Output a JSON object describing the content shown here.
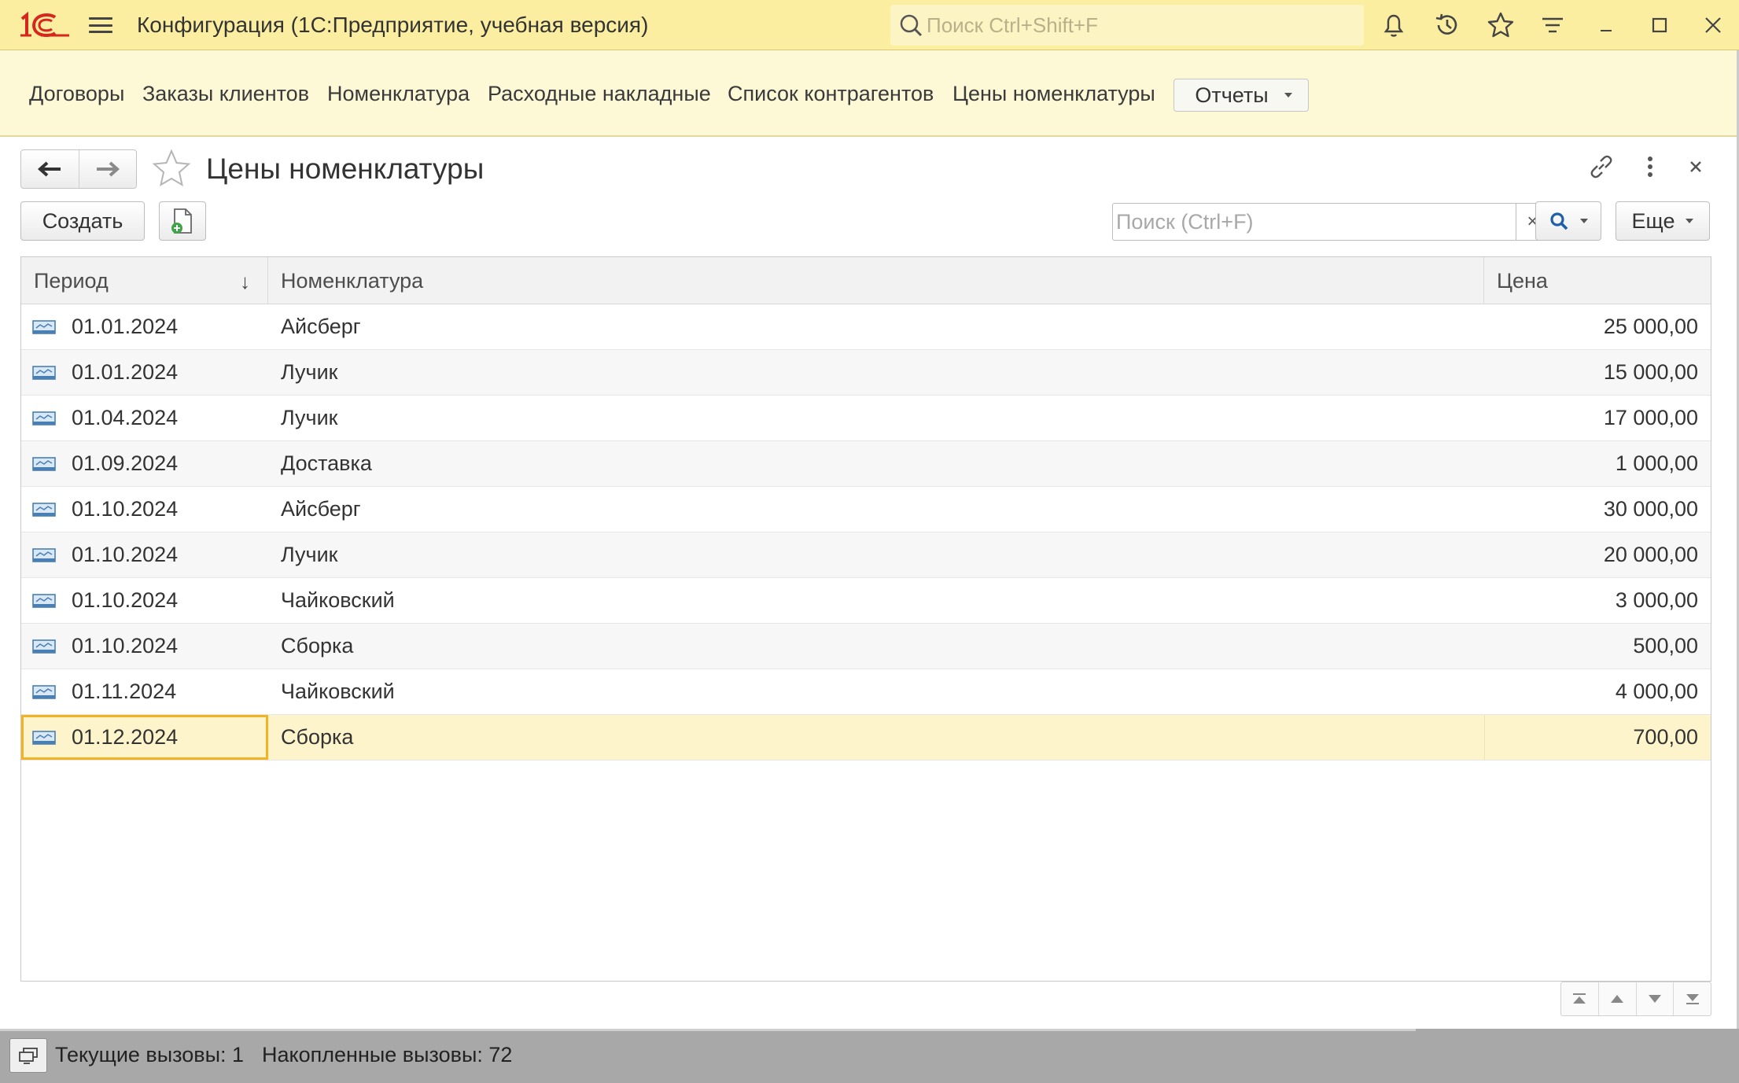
{
  "app": {
    "logo_text": "1С",
    "title": "Конфигурация  (1С:Предприятие, учебная версия)",
    "search_placeholder": "Поиск Ctrl+Shift+F",
    "icons": [
      "bell-icon",
      "history-icon",
      "star-icon",
      "funnel-menu-icon",
      "minimize-icon",
      "maximize-icon",
      "close-icon"
    ]
  },
  "sections": {
    "links": [
      "Договоры",
      "Заказы клиентов",
      "Номенклатура",
      "Расходные накладные",
      "Список контрагентов",
      "Цены номенклатуры"
    ],
    "reports_label": "Отчеты"
  },
  "form": {
    "title": "Цены номенклатуры",
    "create_label": "Создать",
    "search_placeholder": "Поиск (Ctrl+F)",
    "clear_label": "×",
    "more_label": "Еще"
  },
  "table": {
    "columns": {
      "period": "Период",
      "item": "Номенклатура",
      "price": "Цена"
    },
    "sort_indicator": "↓",
    "rows": [
      {
        "period": "01.01.2024",
        "item": "Айсберг",
        "price": "25 000,00"
      },
      {
        "period": "01.01.2024",
        "item": "Лучик",
        "price": "15 000,00"
      },
      {
        "period": "01.04.2024",
        "item": "Лучик",
        "price": "17 000,00"
      },
      {
        "period": "01.09.2024",
        "item": "Доставка",
        "price": "1 000,00"
      },
      {
        "period": "01.10.2024",
        "item": "Айсберг",
        "price": "30 000,00"
      },
      {
        "period": "01.10.2024",
        "item": "Лучик",
        "price": "20 000,00"
      },
      {
        "period": "01.10.2024",
        "item": "Чайковский",
        "price": "3 000,00"
      },
      {
        "period": "01.10.2024",
        "item": "Сборка",
        "price": "500,00"
      },
      {
        "period": "01.11.2024",
        "item": "Чайковский",
        "price": "4 000,00"
      },
      {
        "period": "01.12.2024",
        "item": "Сборка",
        "price": "700,00"
      }
    ],
    "selected_row": 9
  },
  "status": {
    "current_calls": "Текущие вызовы: 1",
    "accumulated_calls": "Накопленные вызовы: 72"
  },
  "colors": {
    "titlebar": "#fbeea0",
    "sections_bar": "#fdf8d6",
    "selection_outline": "#f2b325",
    "selected_row": "#fdf4cc",
    "logo_red": "#d7261e"
  }
}
